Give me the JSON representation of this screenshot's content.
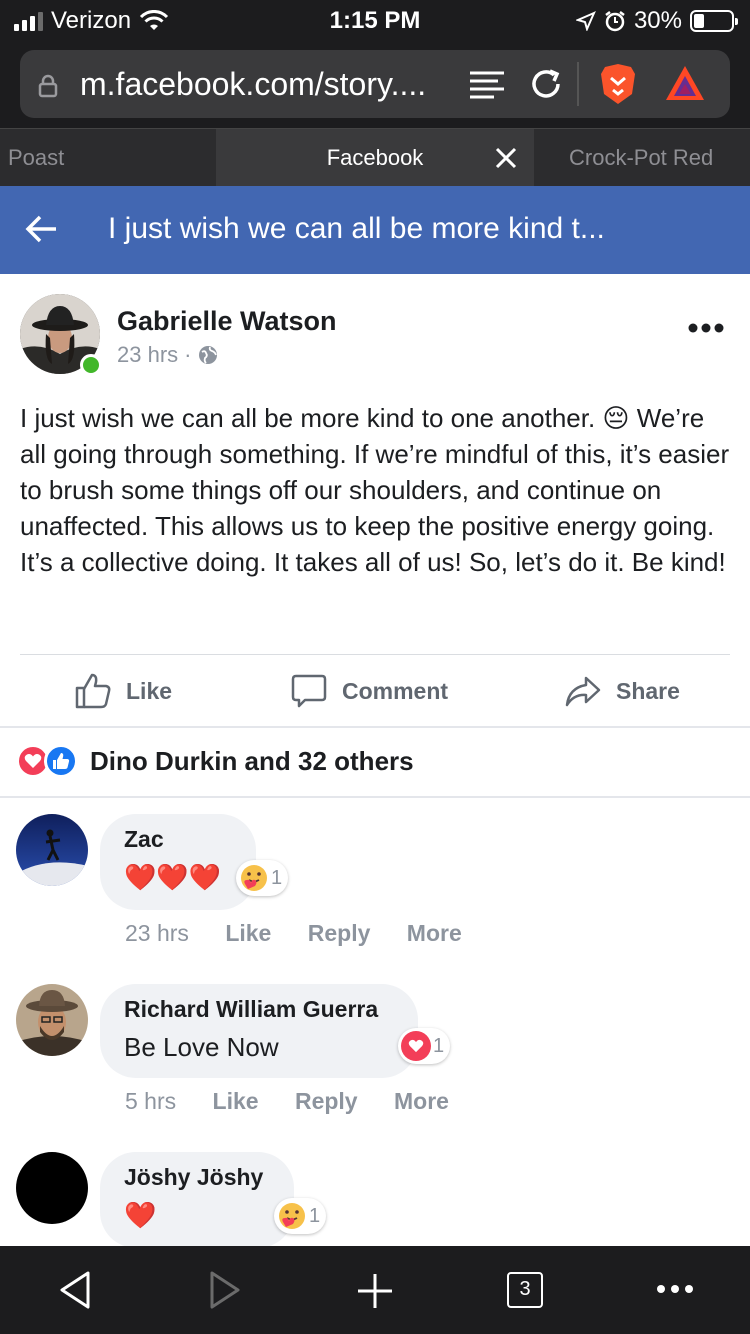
{
  "status_bar": {
    "carrier": "Verizon",
    "time": "1:15 PM",
    "battery": "30%"
  },
  "browser": {
    "url": "m.facebook.com/story....",
    "tabs": [
      {
        "label": "Poast"
      },
      {
        "label": "Facebook"
      },
      {
        "label": "Crock-Pot Red"
      }
    ],
    "tab_count": "3"
  },
  "header": {
    "title": "I just wish we can all be more kind t..."
  },
  "post": {
    "author": "Gabrielle Watson",
    "time": "23 hrs",
    "separator": "·",
    "text": "I just wish we can all be more kind to one another. 😔 We’re all going through something. If we’re mindful of this, it’s easier to brush some things off our shoulders, and continue on unaffected. This allows us to keep the positive energy going. It’s a collective doing. It takes all of us! So, let’s do it. Be kind!",
    "actions": {
      "like": "Like",
      "comment": "Comment",
      "share": "Share"
    },
    "reactions_text": "Dino Durkin and 32 others"
  },
  "comments": [
    {
      "name": "Zac",
      "text": "❤️❤️❤️",
      "reaction_count": "1",
      "time": "23 hrs",
      "like": "Like",
      "reply": "Reply",
      "more": "More"
    },
    {
      "name": "Richard William Guerra",
      "text": "Be Love Now",
      "reaction_count": "1",
      "time": "5 hrs",
      "like": "Like",
      "reply": "Reply",
      "more": "More"
    },
    {
      "name": "Jöshy Jöshy",
      "text": "❤️",
      "reaction_count": "1"
    }
  ],
  "colors": {
    "facebook_blue": "#4267b2",
    "online_green": "#42b72a",
    "heart_red": "#f33e58",
    "like_blue": "#1877f2"
  }
}
